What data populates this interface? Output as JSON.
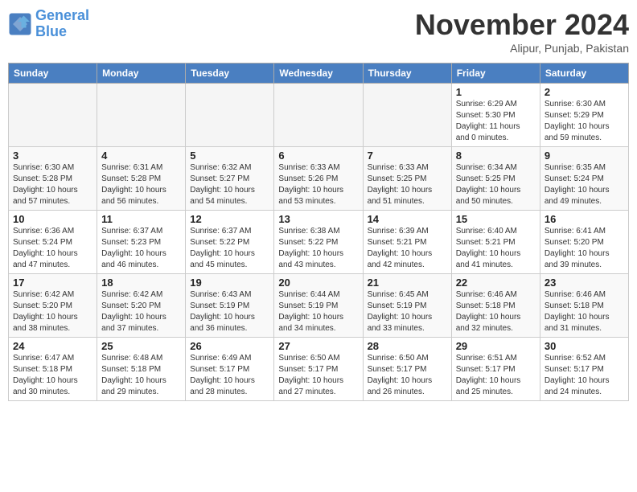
{
  "header": {
    "logo_line1": "General",
    "logo_line2": "Blue",
    "month": "November 2024",
    "location": "Alipur, Punjab, Pakistan"
  },
  "weekdays": [
    "Sunday",
    "Monday",
    "Tuesday",
    "Wednesday",
    "Thursday",
    "Friday",
    "Saturday"
  ],
  "weeks": [
    [
      {
        "day": "",
        "detail": ""
      },
      {
        "day": "",
        "detail": ""
      },
      {
        "day": "",
        "detail": ""
      },
      {
        "day": "",
        "detail": ""
      },
      {
        "day": "",
        "detail": ""
      },
      {
        "day": "1",
        "detail": "Sunrise: 6:29 AM\nSunset: 5:30 PM\nDaylight: 11 hours and 0 minutes."
      },
      {
        "day": "2",
        "detail": "Sunrise: 6:30 AM\nSunset: 5:29 PM\nDaylight: 10 hours and 59 minutes."
      }
    ],
    [
      {
        "day": "3",
        "detail": "Sunrise: 6:30 AM\nSunset: 5:28 PM\nDaylight: 10 hours and 57 minutes."
      },
      {
        "day": "4",
        "detail": "Sunrise: 6:31 AM\nSunset: 5:28 PM\nDaylight: 10 hours and 56 minutes."
      },
      {
        "day": "5",
        "detail": "Sunrise: 6:32 AM\nSunset: 5:27 PM\nDaylight: 10 hours and 54 minutes."
      },
      {
        "day": "6",
        "detail": "Sunrise: 6:33 AM\nSunset: 5:26 PM\nDaylight: 10 hours and 53 minutes."
      },
      {
        "day": "7",
        "detail": "Sunrise: 6:33 AM\nSunset: 5:25 PM\nDaylight: 10 hours and 51 minutes."
      },
      {
        "day": "8",
        "detail": "Sunrise: 6:34 AM\nSunset: 5:25 PM\nDaylight: 10 hours and 50 minutes."
      },
      {
        "day": "9",
        "detail": "Sunrise: 6:35 AM\nSunset: 5:24 PM\nDaylight: 10 hours and 49 minutes."
      }
    ],
    [
      {
        "day": "10",
        "detail": "Sunrise: 6:36 AM\nSunset: 5:24 PM\nDaylight: 10 hours and 47 minutes."
      },
      {
        "day": "11",
        "detail": "Sunrise: 6:37 AM\nSunset: 5:23 PM\nDaylight: 10 hours and 46 minutes."
      },
      {
        "day": "12",
        "detail": "Sunrise: 6:37 AM\nSunset: 5:22 PM\nDaylight: 10 hours and 45 minutes."
      },
      {
        "day": "13",
        "detail": "Sunrise: 6:38 AM\nSunset: 5:22 PM\nDaylight: 10 hours and 43 minutes."
      },
      {
        "day": "14",
        "detail": "Sunrise: 6:39 AM\nSunset: 5:21 PM\nDaylight: 10 hours and 42 minutes."
      },
      {
        "day": "15",
        "detail": "Sunrise: 6:40 AM\nSunset: 5:21 PM\nDaylight: 10 hours and 41 minutes."
      },
      {
        "day": "16",
        "detail": "Sunrise: 6:41 AM\nSunset: 5:20 PM\nDaylight: 10 hours and 39 minutes."
      }
    ],
    [
      {
        "day": "17",
        "detail": "Sunrise: 6:42 AM\nSunset: 5:20 PM\nDaylight: 10 hours and 38 minutes."
      },
      {
        "day": "18",
        "detail": "Sunrise: 6:42 AM\nSunset: 5:20 PM\nDaylight: 10 hours and 37 minutes."
      },
      {
        "day": "19",
        "detail": "Sunrise: 6:43 AM\nSunset: 5:19 PM\nDaylight: 10 hours and 36 minutes."
      },
      {
        "day": "20",
        "detail": "Sunrise: 6:44 AM\nSunset: 5:19 PM\nDaylight: 10 hours and 34 minutes."
      },
      {
        "day": "21",
        "detail": "Sunrise: 6:45 AM\nSunset: 5:19 PM\nDaylight: 10 hours and 33 minutes."
      },
      {
        "day": "22",
        "detail": "Sunrise: 6:46 AM\nSunset: 5:18 PM\nDaylight: 10 hours and 32 minutes."
      },
      {
        "day": "23",
        "detail": "Sunrise: 6:46 AM\nSunset: 5:18 PM\nDaylight: 10 hours and 31 minutes."
      }
    ],
    [
      {
        "day": "24",
        "detail": "Sunrise: 6:47 AM\nSunset: 5:18 PM\nDaylight: 10 hours and 30 minutes."
      },
      {
        "day": "25",
        "detail": "Sunrise: 6:48 AM\nSunset: 5:18 PM\nDaylight: 10 hours and 29 minutes."
      },
      {
        "day": "26",
        "detail": "Sunrise: 6:49 AM\nSunset: 5:17 PM\nDaylight: 10 hours and 28 minutes."
      },
      {
        "day": "27",
        "detail": "Sunrise: 6:50 AM\nSunset: 5:17 PM\nDaylight: 10 hours and 27 minutes."
      },
      {
        "day": "28",
        "detail": "Sunrise: 6:50 AM\nSunset: 5:17 PM\nDaylight: 10 hours and 26 minutes."
      },
      {
        "day": "29",
        "detail": "Sunrise: 6:51 AM\nSunset: 5:17 PM\nDaylight: 10 hours and 25 minutes."
      },
      {
        "day": "30",
        "detail": "Sunrise: 6:52 AM\nSunset: 5:17 PM\nDaylight: 10 hours and 24 minutes."
      }
    ]
  ]
}
